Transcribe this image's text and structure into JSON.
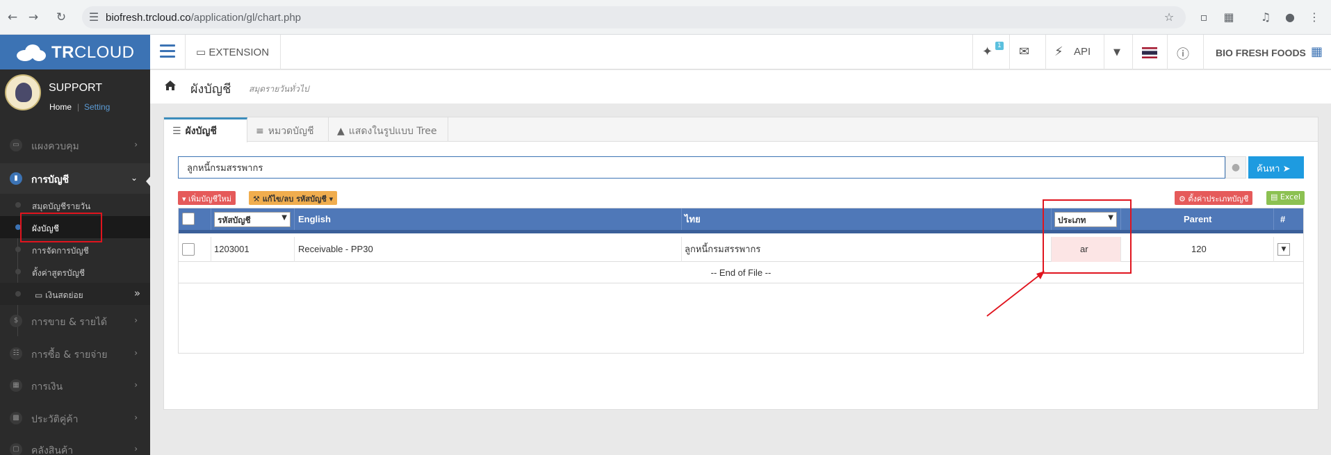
{
  "browser": {
    "url_host": "biofresh.trcloud.co",
    "url_path": "/application/gl/chart.php"
  },
  "brand": {
    "logo_bold": "TR",
    "logo_rest": "CLOUD",
    "color": "#3c73b4"
  },
  "profile": {
    "name": "SUPPORT",
    "home_link": "Home",
    "separator": "|",
    "setting_link": "Setting"
  },
  "sidebar": {
    "items": [
      {
        "label": "แผงควบคุม",
        "icon": "monitor-icon"
      },
      {
        "label": "การบัญชี",
        "icon": "book-icon"
      },
      {
        "label": "การขาย & รายได้",
        "icon": "dollar-icon"
      },
      {
        "label": "การซื้อ & รายจ่าย",
        "icon": "cart-icon"
      },
      {
        "label": "การเงิน",
        "icon": "calendar-icon"
      },
      {
        "label": "ประวัติคู่ค้า",
        "icon": "contact-icon"
      },
      {
        "label": "คลังสินค้า",
        "icon": "box-icon"
      }
    ],
    "submenu": [
      {
        "label": "สมุดบัญชีรายวัน"
      },
      {
        "label": "ผังบัญชี"
      },
      {
        "label": "การจัดการบัญชี"
      },
      {
        "label": "ตั้งค่าสูตรบัญชี"
      },
      {
        "label": "เงินสดย่อย"
      }
    ]
  },
  "topnav": {
    "extension_label": "EXTENSION",
    "badge": "1",
    "api_label": "API",
    "company": "BIO FRESH FOODS"
  },
  "breadcrumb": {
    "title": "ผังบัญชี",
    "subtitle": "สมุดรายวันทั่วไป"
  },
  "tabs": [
    {
      "label": "ผังบัญชี",
      "icon": "list-icon"
    },
    {
      "label": "หมวดบัญชี",
      "icon": "indent-icon"
    },
    {
      "label": "แสดงในรูปแบบ Tree",
      "icon": "sitemap-icon"
    }
  ],
  "search": {
    "value": "ลูกหนี้กรมสรรพากร",
    "button_label": "ค้นหา"
  },
  "actions": {
    "add_label": "เพิ่มบัญชีใหม่",
    "edit_label": "แก้ไข/ลบ รหัสบัญชี",
    "type_settings_label": "ตั้งค่าประเภทบัญชี",
    "excel_label": "Excel"
  },
  "table": {
    "headers": {
      "code_select": "รหัสบัญชี",
      "english": "English",
      "thai": "ไทย",
      "type_select": "ประเภท",
      "parent": "Parent",
      "hash": "#"
    },
    "rows": [
      {
        "code": "1203001",
        "english": "Receivable - PP30",
        "thai": "ลูกหนี้กรมสรรพากร",
        "type": "ar",
        "parent": "120"
      }
    ],
    "end_label": "-- End of File --"
  },
  "annotation_color": "#e0141e"
}
